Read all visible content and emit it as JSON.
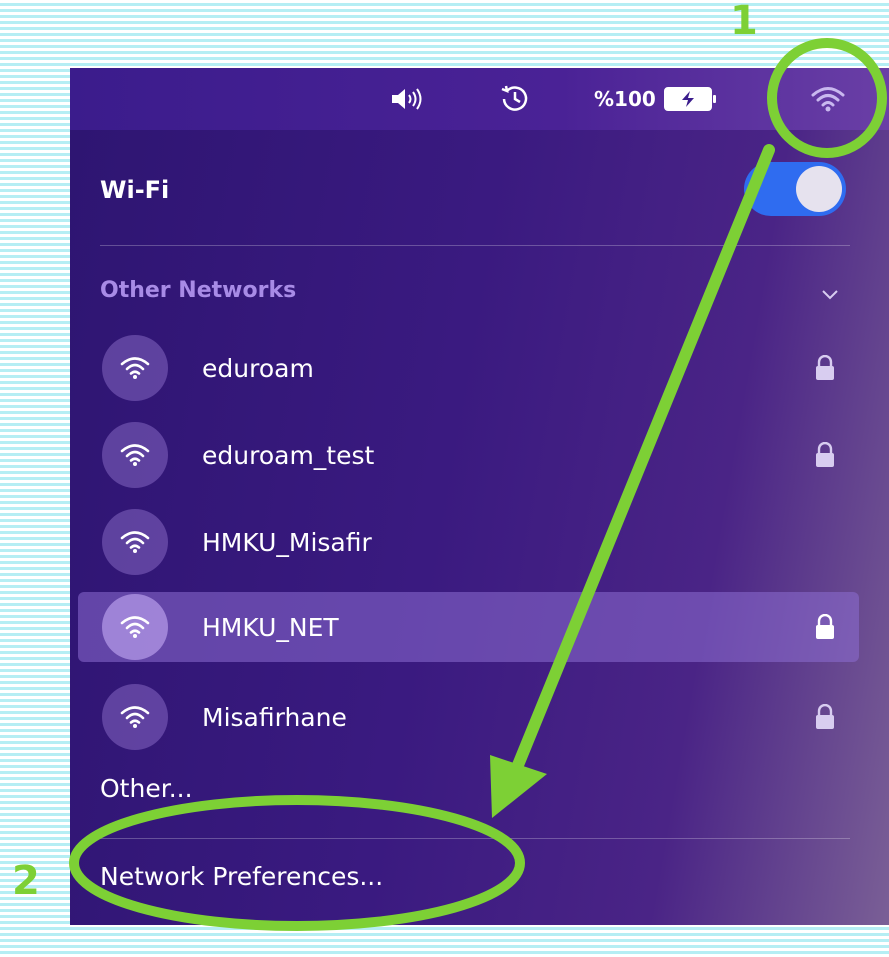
{
  "menubar": {
    "battery_label": "%100",
    "icons": [
      "volume-icon",
      "time-machine-icon",
      "battery-charging-icon",
      "wifi-icon"
    ]
  },
  "panel": {
    "wifi_title": "Wi-Fi",
    "wifi_enabled": true,
    "other_networks_title": "Other Networks",
    "networks": [
      {
        "name": "eduroam",
        "locked": true,
        "selected": false
      },
      {
        "name": "eduroam_test",
        "locked": true,
        "selected": false
      },
      {
        "name": "HMKU_Misafir",
        "locked": false,
        "selected": false
      },
      {
        "name": "HMKU_NET",
        "locked": true,
        "selected": true
      },
      {
        "name": "Misafirhane",
        "locked": true,
        "selected": false
      }
    ],
    "other_label": "Other...",
    "network_preferences_label": "Network Preferences..."
  },
  "annotations": {
    "step1": "1",
    "step2": "2",
    "color": "#7dd035"
  },
  "colors": {
    "toggle_on": "#2f6cf0",
    "section_title": "#a88be6",
    "panel_bg": "#3a1a80"
  }
}
